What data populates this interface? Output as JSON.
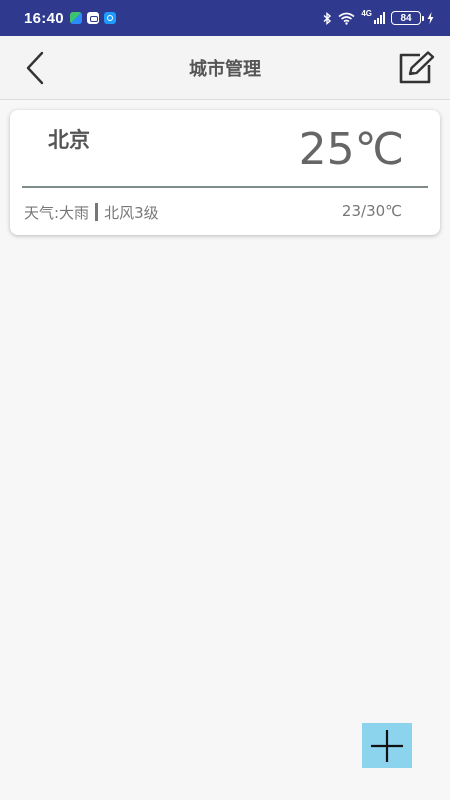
{
  "status_bar": {
    "time": "16:40",
    "network_label": "4G",
    "battery_level": "84"
  },
  "header": {
    "title": "城市管理",
    "back_icon": "chevron-left-icon",
    "edit_icon": "edit-icon"
  },
  "cities": [
    {
      "name": "北京",
      "temperature": "25℃",
      "weather": "天气:大雨",
      "wind": "北风3级",
      "range": "23/30℃"
    }
  ],
  "fab": {
    "icon": "plus-icon"
  },
  "colors": {
    "status_bar_bg": "#2f3a8f",
    "header_bg": "#f4f4f4",
    "page_bg": "#f7f7f7",
    "fab_bg": "#8cd3ee",
    "divider": "#7f8a8a"
  }
}
